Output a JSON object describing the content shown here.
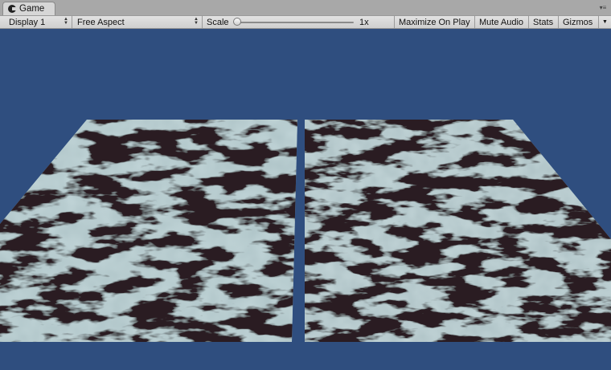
{
  "window": {
    "tab_label": "Game",
    "tab_icon": "game-view-icon",
    "tab_menu_icon": "tab-menu-icon"
  },
  "toolbar": {
    "display_select": "Display 1",
    "aspect_select": "Free Aspect",
    "scale_label": "Scale",
    "scale_value": "1x",
    "scale_level": 0,
    "maximize_on_play": "Maximize On Play",
    "mute_audio": "Mute Audio",
    "stats": "Stats",
    "gizmos": "Gizmos"
  },
  "scene": {
    "background_color": "#2f4e7f",
    "planes": [
      {
        "name": "left-marble-plane",
        "base_color": "#a6bcc0",
        "vein_color": "#2b1f24"
      },
      {
        "name": "right-marble-plane",
        "base_color": "#a4b9bd",
        "vein_color": "#2b1f24"
      }
    ]
  }
}
